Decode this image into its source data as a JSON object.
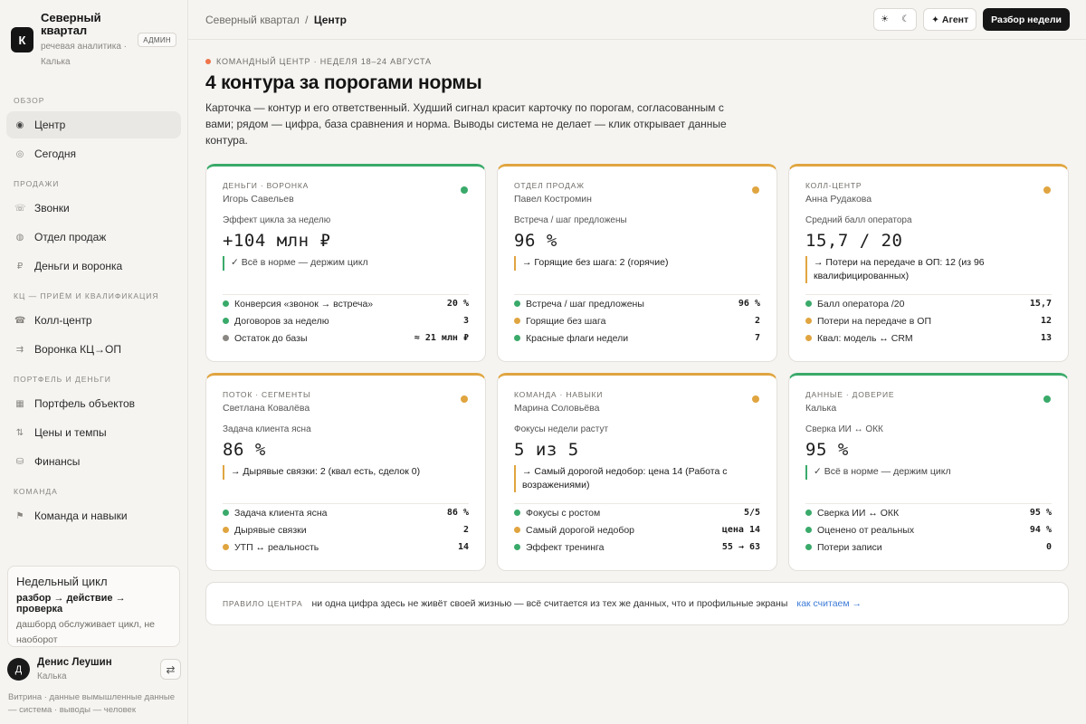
{
  "brand": {
    "logo_letter": "К",
    "name": "Северный квартал",
    "subtitle": "речевая аналитика · Калька",
    "badge": "АДМИН"
  },
  "sidebar": {
    "sections": [
      {
        "label": "ОБЗОР",
        "items": [
          {
            "label": "Центр",
            "icon": "target-icon",
            "glyph": "◉",
            "active": true
          },
          {
            "label": "Сегодня",
            "icon": "circle-icon",
            "glyph": "◎",
            "active": false
          }
        ]
      },
      {
        "label": "ПРОДАЖИ",
        "items": [
          {
            "label": "Звонки",
            "icon": "calls-icon",
            "glyph": "☏",
            "active": false
          },
          {
            "label": "Отдел продаж",
            "icon": "sales-icon",
            "glyph": "◍",
            "active": false
          },
          {
            "label": "Деньги и воронка",
            "icon": "ruble-icon",
            "glyph": "₽",
            "active": false
          }
        ]
      },
      {
        "label": "КЦ — ПРИЁМ И КВАЛИФИКАЦИЯ",
        "items": [
          {
            "label": "Колл-центр",
            "icon": "phone-icon",
            "glyph": "☎",
            "active": false
          },
          {
            "label": "Воронка КЦ→ОП",
            "icon": "funnel-icon",
            "glyph": "⇉",
            "active": false
          }
        ]
      },
      {
        "label": "ПОРТФЕЛЬ И ДЕНЬГИ",
        "items": [
          {
            "label": "Портфель объектов",
            "icon": "grid-icon",
            "glyph": "▦",
            "active": false
          },
          {
            "label": "Цены и темпы",
            "icon": "arrows-icon",
            "glyph": "⇅",
            "active": false
          },
          {
            "label": "Финансы",
            "icon": "coins-icon",
            "glyph": "⛁",
            "active": false
          }
        ]
      },
      {
        "label": "КОМАНДА",
        "items": [
          {
            "label": "Команда и навыки",
            "icon": "flag-icon",
            "glyph": "⚑",
            "active": false
          }
        ]
      }
    ],
    "weekly": {
      "title": "Недельный цикл",
      "flow": "разбор → действие → проверка",
      "note": "дашборд обслуживает цикл, не наоборот"
    },
    "user": {
      "initial": "Д",
      "name": "Денис Леушин",
      "org": "Калька",
      "switch_glyph": "⇄"
    },
    "disclaimer": "Витрина · данные вымышленные данные — система · выводы — человек"
  },
  "topbar": {
    "breadcrumb_parent": "Северный квартал",
    "breadcrumb_sep": "/",
    "breadcrumb_current": "Центр",
    "theme_light": "☀",
    "theme_dark": "☾",
    "agent_label": "✦ Агент",
    "primary_label": "Разбор недели"
  },
  "header": {
    "eyebrow": "КОМАНДНЫЙ ЦЕНТР · НЕДЕЛЯ 18–24 АВГУСТА",
    "title": "4 контура за порогами нормы",
    "description": "Карточка — контур и его ответственный. Худший сигнал красит карточку по порогам, согласованным с вами; рядом — цифра, база сравнения и норма. Выводы система не делает — клик открывает данные контура."
  },
  "colors": {
    "ok": "#3aaa6a",
    "warn": "#e0a540",
    "neutral": "#8a8782",
    "accent_dot": "#f0744a"
  },
  "cards": [
    {
      "status": "ok",
      "category": "ДЕНЬГИ · ВОРОНКА",
      "owner": "Игорь Савельев",
      "metric_label": "Эффект цикла за неделю",
      "value": "+104 млн ₽",
      "signal": "✓ Всё в норме — держим цикл",
      "rows": [
        {
          "label": "Конверсия «звонок → встреча»",
          "value": "20 %",
          "status": "ok"
        },
        {
          "label": "Договоров за неделю",
          "value": "3",
          "status": "ok"
        },
        {
          "label": "Остаток до базы",
          "value": "≈ 21 млн ₽",
          "status": "neutral"
        }
      ]
    },
    {
      "status": "warn",
      "category": "ОТДЕЛ ПРОДАЖ",
      "owner": "Павел Костромин",
      "metric_label": "Встреча / шаг предложены",
      "value": "96 %",
      "signal": "→ Горящие без шага: 2 (горячие)",
      "rows": [
        {
          "label": "Встреча / шаг предложены",
          "value": "96 %",
          "status": "ok"
        },
        {
          "label": "Горящие без шага",
          "value": "2",
          "status": "warn"
        },
        {
          "label": "Красные флаги недели",
          "value": "7",
          "status": "ok"
        }
      ]
    },
    {
      "status": "warn",
      "category": "КОЛЛ-ЦЕНТР",
      "owner": "Анна Рудакова",
      "metric_label": "Средний балл оператора",
      "value": "15,7 / 20",
      "signal": "→ Потери на передаче в ОП: 12 (из 96 квалифицированных)",
      "rows": [
        {
          "label": "Балл оператора /20",
          "value": "15,7",
          "status": "ok"
        },
        {
          "label": "Потери на передаче в ОП",
          "value": "12",
          "status": "warn"
        },
        {
          "label": "Квал: модель ↔ CRM",
          "value": "13",
          "status": "warn"
        }
      ]
    },
    {
      "status": "warn",
      "category": "ПОТОК · СЕГМЕНТЫ",
      "owner": "Светлана Ковалёва",
      "metric_label": "Задача клиента ясна",
      "value": "86 %",
      "signal": "→ Дырявые связки: 2 (квал есть, сделок 0)",
      "rows": [
        {
          "label": "Задача клиента ясна",
          "value": "86 %",
          "status": "ok"
        },
        {
          "label": "Дырявые связки",
          "value": "2",
          "status": "warn"
        },
        {
          "label": "УТП ↔ реальность",
          "value": "14",
          "status": "warn"
        }
      ]
    },
    {
      "status": "warn",
      "category": "КОМАНДА · НАВЫКИ",
      "owner": "Марина Соловьёва",
      "metric_label": "Фокусы недели растут",
      "value": "5 из 5",
      "signal": "→ Самый дорогой недобор: цена 14 (Работа с возражениями)",
      "rows": [
        {
          "label": "Фокусы с ростом",
          "value": "5/5",
          "status": "ok"
        },
        {
          "label": "Самый дорогой недобор",
          "value": "цена 14",
          "status": "warn"
        },
        {
          "label": "Эффект тренинга",
          "value": "55 → 63",
          "status": "ok"
        }
      ]
    },
    {
      "status": "ok",
      "category": "ДАННЫЕ · ДОВЕРИЕ",
      "owner": "Калька",
      "metric_label": "Сверка ИИ ↔ ОКК",
      "value": "95 %",
      "signal": "✓ Всё в норме — держим цикл",
      "rows": [
        {
          "label": "Сверка ИИ ↔ ОКК",
          "value": "95 %",
          "status": "ok"
        },
        {
          "label": "Оценено от реальных",
          "value": "94 %",
          "status": "ok"
        },
        {
          "label": "Потери записи",
          "value": "0",
          "status": "ok"
        }
      ]
    }
  ],
  "rule": {
    "label": "ПРАВИЛО ЦЕНТРА",
    "text": "ни одна цифра здесь не живёт своей жизнью — всё считается из тех же данных, что и профильные экраны",
    "link": "как считаем →"
  }
}
